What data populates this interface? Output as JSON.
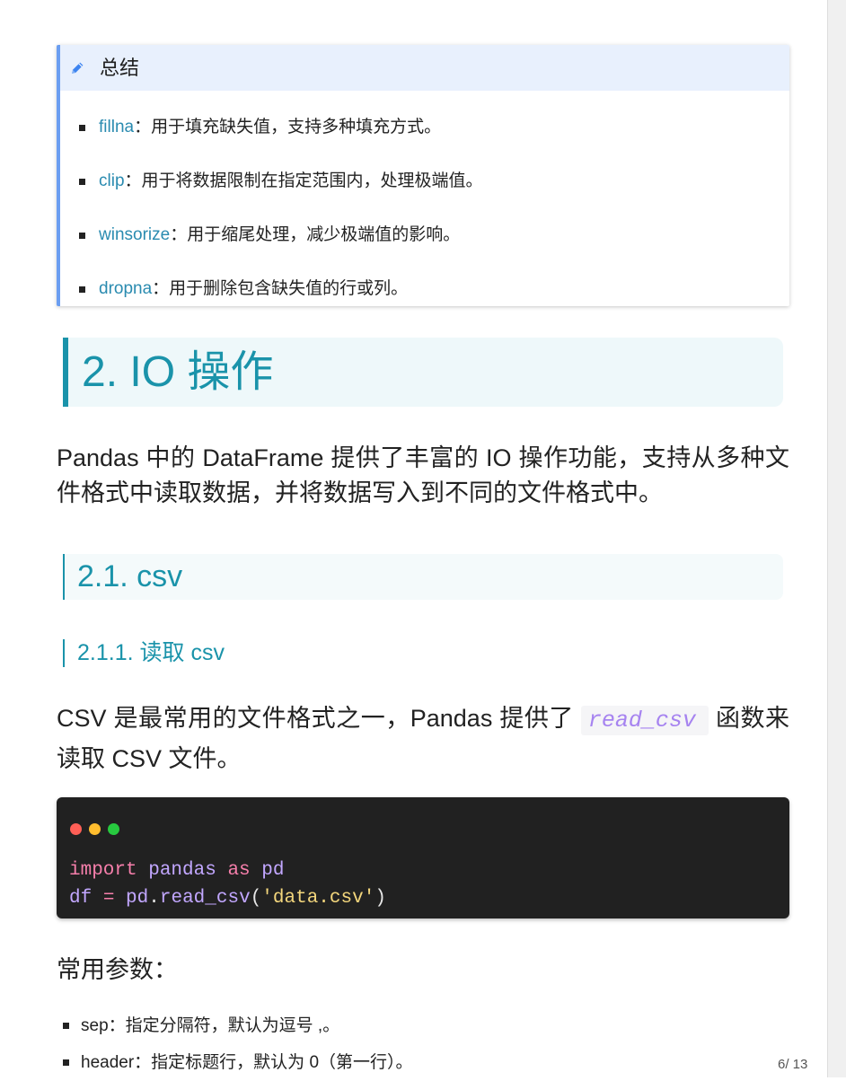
{
  "summary": {
    "title": "总结",
    "items": [
      {
        "term": "fillna",
        "desc": "：用于填充缺失值，支持多种填充方式。"
      },
      {
        "term": "clip",
        "desc": "：用于将数据限制在指定范围内，处理极端值。"
      },
      {
        "term": "winsorize",
        "desc": "：用于缩尾处理，减少极端值的影响。"
      },
      {
        "term": "dropna",
        "desc": "：用于删除包含缺失值的行或列。"
      }
    ]
  },
  "io_section": {
    "heading": "2. IO 操作",
    "intro": "Pandas 中的 DataFrame 提供了丰富的 IO 操作功能，支持从多种文件格式中读取数据，并将数据写入到不同的文件格式中。",
    "csv": {
      "heading": "2.1. csv",
      "read": {
        "heading": "2.1.1. 读取 csv",
        "description": {
          "before": "CSV 是最常用的文件格式之一，Pandas 提供了 ",
          "code": "read_csv",
          "after": " 函数来读取 CSV 文件。"
        },
        "code": {
          "lines": [
            [
              "import ",
              "pandas ",
              "as ",
              "pd"
            ],
            [
              "df ",
              "= ",
              "pd",
              ".",
              "read_csv",
              "(",
              "'data.csv'",
              ")"
            ]
          ]
        },
        "params_label": "常用参数：",
        "params": [
          "sep：指定分隔符，默认为逗号 ,。",
          "header：指定标题行，默认为 0（第一行）。"
        ]
      }
    }
  },
  "page_number": "6/ 13",
  "icons": {
    "callout": "pencil-icon",
    "window_controls": [
      "window-close-dot-icon",
      "window-minimize-dot-icon",
      "window-maximize-dot-icon"
    ]
  },
  "colors": {
    "text": "#222222",
    "accent": "#1a93aa",
    "heading_bg": "#eef8fa",
    "subheading_bg": "#f4fafb",
    "callout_border": "#6b9ef1",
    "callout_header_bg": "#e8f0fd",
    "callout_icon": "#3d84f0",
    "term": "#2a8bb0",
    "inline_code": "#a683f0",
    "inline_code_bg": "#f5f5f7",
    "code_bg": "#212121",
    "code_keyword": "#f67fab",
    "code_name": "#c2a7ff",
    "code_punct": "#e6e6e6",
    "code_string": "#f3d67c",
    "dot_red": "#ff5f56",
    "dot_yellow": "#ffbd2e",
    "dot_green": "#27c93f",
    "page_number": "#555555",
    "viewer_margin": "#f0f0f0"
  }
}
